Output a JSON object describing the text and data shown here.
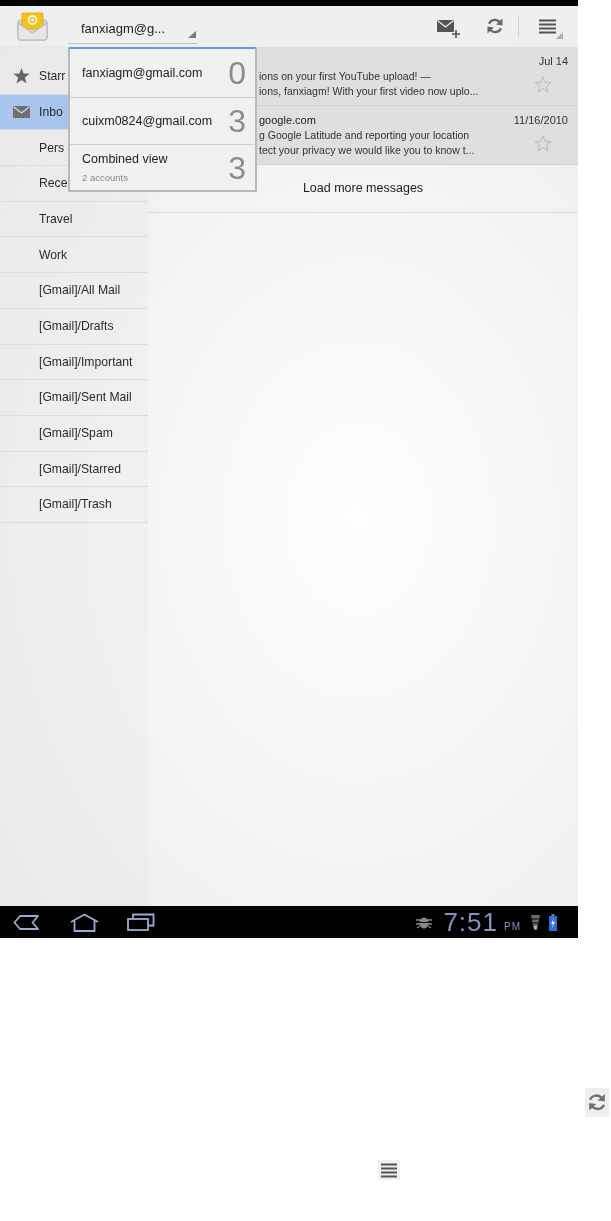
{
  "action_bar": {
    "account": "fanxiagm@g..."
  },
  "account_menu": {
    "items": [
      {
        "label": "fanxiagm@gmail.com",
        "count": "0"
      },
      {
        "label": "cuixm0824@gmail.com",
        "count": "3"
      },
      {
        "label": "Combined view",
        "detail": "2 accounts",
        "count": "3"
      }
    ]
  },
  "sidebar": {
    "items": [
      {
        "kind": "starred",
        "label": "Starr",
        "selected": false
      },
      {
        "kind": "inbox",
        "label": "Inbo",
        "selected": true
      },
      {
        "kind": "label",
        "label": "Pers",
        "selected": false
      },
      {
        "kind": "label",
        "label": "Rece",
        "selected": false
      },
      {
        "kind": "label",
        "label": "Travel",
        "selected": false
      },
      {
        "kind": "label",
        "label": "Work",
        "selected": false
      },
      {
        "kind": "label",
        "label": "[Gmail]/All Mail",
        "selected": false
      },
      {
        "kind": "label",
        "label": "[Gmail]/Drafts",
        "selected": false
      },
      {
        "kind": "label",
        "label": "[Gmail]/Important",
        "selected": false
      },
      {
        "kind": "label",
        "label": "[Gmail]/Sent Mail",
        "selected": false
      },
      {
        "kind": "label",
        "label": "[Gmail]/Spam",
        "selected": false
      },
      {
        "kind": "label",
        "label": "[Gmail]/Starred",
        "selected": false
      },
      {
        "kind": "label",
        "label": "[Gmail]/Trash",
        "selected": false
      }
    ]
  },
  "messages": [
    {
      "subject": "ions on your first YouTube upload! —",
      "snippet": "ions, fanxiagm! With your first video now uplo...",
      "date": "Jul 14",
      "read": true,
      "starred": false
    },
    {
      "sender": "google.com",
      "subject": "g Google Latitude and reporting your location",
      "snippet": "tect your privacy we would like you to know t...",
      "date": "11/16/2010",
      "read": true,
      "starred": false
    }
  ],
  "load_more": "Load more messages",
  "system_bar": {
    "time": "7:51",
    "period": "PM"
  }
}
